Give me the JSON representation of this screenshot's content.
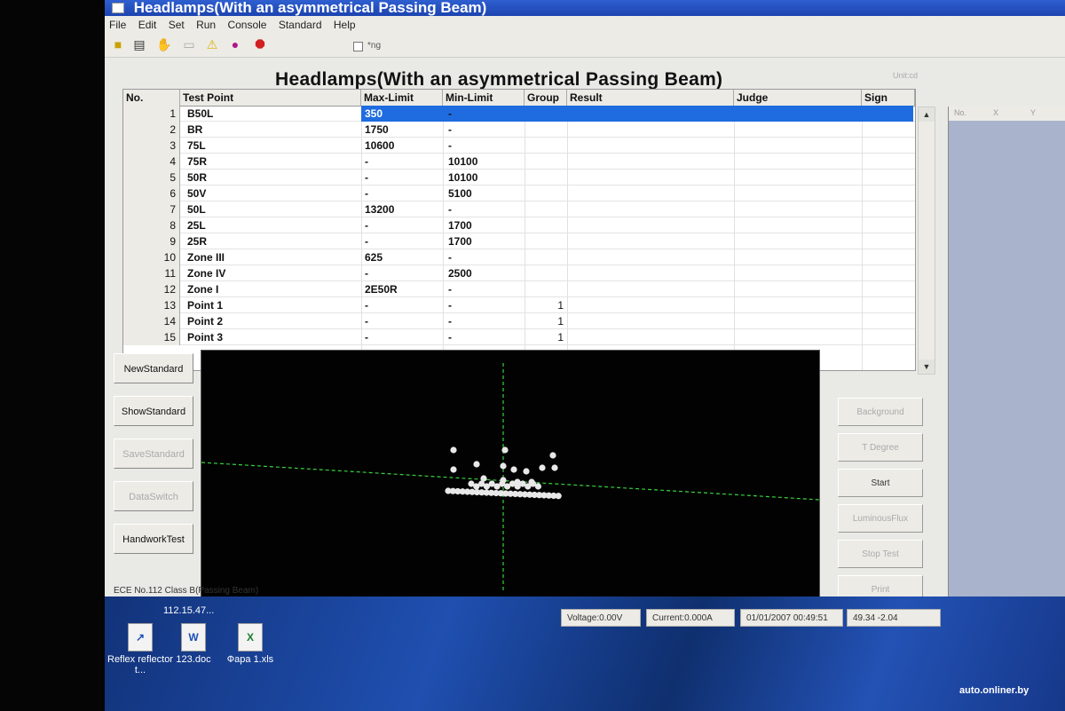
{
  "window": {
    "title": "Headlamps(With an asymmetrical Passing Beam)"
  },
  "menu": [
    "File",
    "Edit",
    "Set",
    "Run",
    "Console",
    "Standard",
    "Help"
  ],
  "toolbar": {
    "icons": [
      "open-folder-icon",
      "save-icon",
      "hand-icon",
      "disabled-icon",
      "warning-icon",
      "record-icon",
      "stop-icon"
    ],
    "checkbox_label": "*ng"
  },
  "main": {
    "title": "Headlamps(With an asymmetrical Passing Beam)",
    "unit_label": "Unit:cd"
  },
  "table": {
    "columns": [
      "No.",
      "Test Point",
      "Max-Limit",
      "Min-Limit",
      "Group",
      "Result",
      "Judge",
      "Sign"
    ],
    "rows": [
      {
        "no": "1",
        "point": "B50L",
        "max": "350",
        "min": "-",
        "group": ""
      },
      {
        "no": "2",
        "point": "BR",
        "max": "1750",
        "min": "-",
        "group": ""
      },
      {
        "no": "3",
        "point": "75L",
        "max": "10600",
        "min": "-",
        "group": ""
      },
      {
        "no": "4",
        "point": "75R",
        "max": "-",
        "min": "10100",
        "group": ""
      },
      {
        "no": "5",
        "point": "50R",
        "max": "-",
        "min": "10100",
        "group": ""
      },
      {
        "no": "6",
        "point": "50V",
        "max": "-",
        "min": "5100",
        "group": ""
      },
      {
        "no": "7",
        "point": "50L",
        "max": "13200",
        "min": "-",
        "group": ""
      },
      {
        "no": "8",
        "point": "25L",
        "max": "-",
        "min": "1700",
        "group": ""
      },
      {
        "no": "9",
        "point": "25R",
        "max": "-",
        "min": "1700",
        "group": ""
      },
      {
        "no": "10",
        "point": "Zone III",
        "max": "625",
        "min": "-",
        "group": ""
      },
      {
        "no": "11",
        "point": "Zone IV",
        "max": "-",
        "min": "2500",
        "group": ""
      },
      {
        "no": "12",
        "point": "Zone I",
        "max": "2E50R",
        "min": "-",
        "group": ""
      },
      {
        "no": "13",
        "point": "Point 1",
        "max": "-",
        "min": "-",
        "group": "1"
      },
      {
        "no": "14",
        "point": "Point 2",
        "max": "-",
        "min": "-",
        "group": "1"
      },
      {
        "no": "15",
        "point": "Point 3",
        "max": "-",
        "min": "-",
        "group": "1"
      }
    ]
  },
  "right_pane": {
    "header": [
      "No.",
      "X",
      "Y"
    ]
  },
  "left_buttons": [
    {
      "label": "NewStandard",
      "enabled": true
    },
    {
      "label": "ShowStandard",
      "enabled": true
    },
    {
      "label": "SaveStandard",
      "enabled": false
    },
    {
      "label": "DataSwitch",
      "enabled": false
    },
    {
      "label": "HandworkTest",
      "enabled": true
    }
  ],
  "action_buttons": [
    {
      "label": "Background",
      "enabled": false
    },
    {
      "label": "T Degree",
      "enabled": false
    },
    {
      "label": "Start",
      "enabled": true
    },
    {
      "label": "LuminousFlux",
      "enabled": false
    },
    {
      "label": "Stop Test",
      "enabled": false
    },
    {
      "label": "Print",
      "enabled": false
    }
  ],
  "status": {
    "standard": "ECE No.112 Class B(Passing Beam)",
    "voltage": "Voltage:0.00V",
    "current": "Current:0.000A",
    "datetime": "01/01/2007 00:49:51",
    "coords": "49.34 -2.04"
  },
  "desktop": {
    "header_text": "112.15.47...",
    "icons": [
      {
        "label": "Reflex reflector t...",
        "icon": "shortcut-icon"
      },
      {
        "label": "123.doc",
        "icon": "word-doc-icon"
      },
      {
        "label": "Фара 1.xls",
        "icon": "excel-xls-icon"
      }
    ],
    "watermark": "auto.onliner.by"
  },
  "colors": {
    "selection": "#1e6ce0",
    "titlebar": "#2f5fd0",
    "beam_background": "#020202",
    "crosshair": "#39d13f",
    "desktop": "#1f4fb0"
  }
}
